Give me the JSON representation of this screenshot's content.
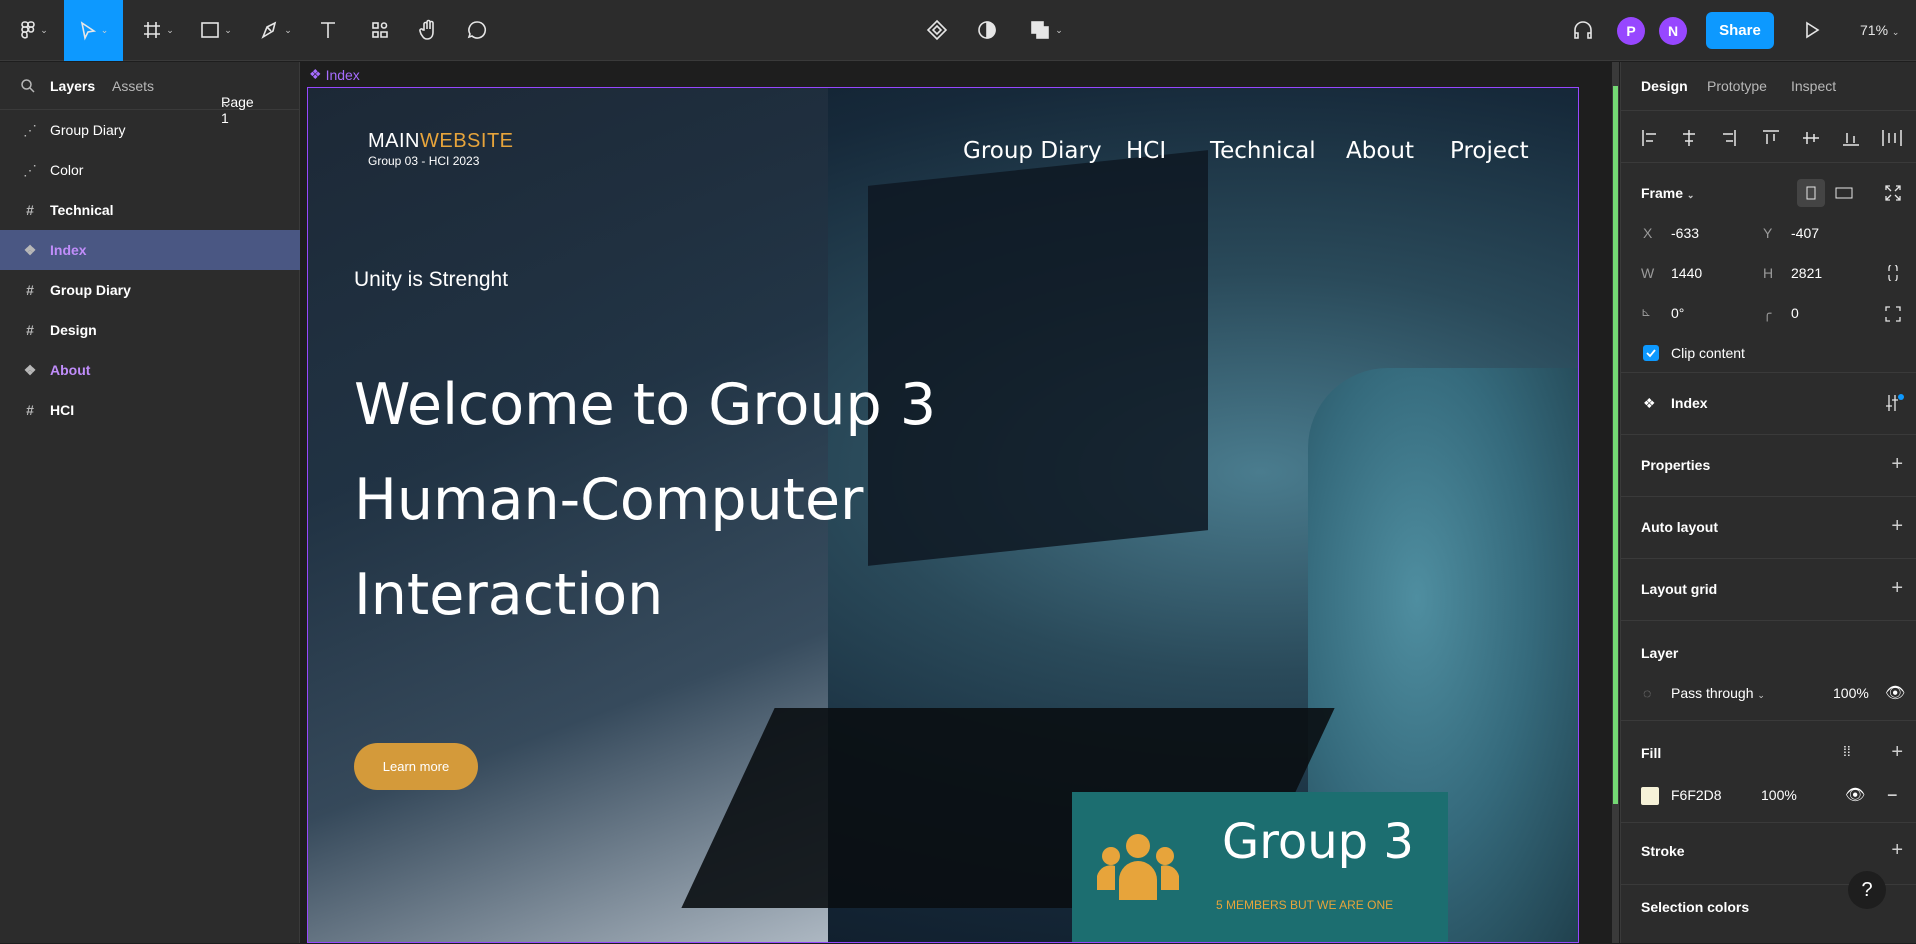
{
  "toolbar": {
    "share_label": "Share",
    "zoom": "71%",
    "avatars": [
      "P",
      "N"
    ]
  },
  "left_panel": {
    "tabs": [
      "Layers",
      "Assets"
    ],
    "page": "Page 1",
    "layers": [
      {
        "name": "Group Diary",
        "icon": "dotted-frame-icon"
      },
      {
        "name": "Color",
        "icon": "dotted-frame-icon"
      },
      {
        "name": "Technical",
        "icon": "frame-icon"
      },
      {
        "name": "Index",
        "icon": "component-icon"
      },
      {
        "name": "Group Diary",
        "icon": "frame-icon"
      },
      {
        "name": "Design",
        "icon": "frame-icon"
      },
      {
        "name": "About",
        "icon": "component-icon"
      },
      {
        "name": "HCI",
        "icon": "frame-icon"
      }
    ]
  },
  "canvas": {
    "frame_label": "Index",
    "site": {
      "logo_main": "MAIN",
      "logo_web": "WEBSITE",
      "logo_sub": "Group 03 - HCI 2023",
      "nav": [
        "Group Diary",
        "HCI",
        "Technical",
        "About",
        "Project"
      ],
      "tagline": "Unity is Strenght",
      "hero": [
        "Welcome to Group 3",
        "Human-Computer",
        "Interaction"
      ],
      "button": "Learn more",
      "card_title": "Group 3",
      "card_sub": "5 MEMBERS BUT WE ARE ONE"
    }
  },
  "right_panel": {
    "tabs": [
      "Design",
      "Prototype",
      "Inspect"
    ],
    "frame_label": "Frame",
    "x": "-633",
    "y": "-407",
    "w": "1440",
    "h": "2821",
    "rotation": "0°",
    "radius": "0",
    "clip_content": "Clip content",
    "component": "Index",
    "sections": [
      "Properties",
      "Auto layout",
      "Layout grid"
    ],
    "layer_label": "Layer",
    "blend": "Pass through",
    "opacity": "100%",
    "fill_label": "Fill",
    "fill_hex": "F6F2D8",
    "fill_opacity": "100%",
    "fill_color": "#F6F2D8",
    "stroke": "Stroke",
    "selection_colors": "Selection colors"
  }
}
